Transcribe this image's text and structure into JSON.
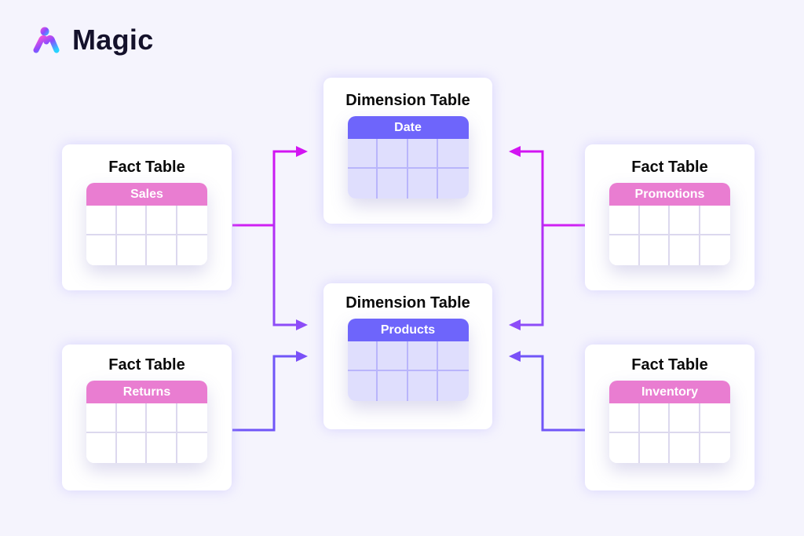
{
  "brand": {
    "name": "Magic",
    "logo_icon": "magic-person-logo-icon"
  },
  "colors": {
    "background": "#f5f4fd",
    "fact_header": "#e97dd1",
    "dimension_header": "#6e65fb",
    "dimension_body": "#dfdefd",
    "connector_magenta": "#d214f2",
    "connector_violet": "#8d4cf8",
    "connector_blue": "#6a5cf8"
  },
  "diagram": {
    "type": "star-schema",
    "dimension_tables": [
      {
        "id": "date",
        "title": "Dimension Table",
        "name": "Date"
      },
      {
        "id": "products",
        "title": "Dimension Table",
        "name": "Products"
      }
    ],
    "fact_tables": [
      {
        "id": "sales",
        "title": "Fact Table",
        "name": "Sales",
        "side": "left",
        "links_to": [
          "date",
          "products"
        ]
      },
      {
        "id": "returns",
        "title": "Fact Table",
        "name": "Returns",
        "side": "left",
        "links_to": [
          "products"
        ]
      },
      {
        "id": "promotions",
        "title": "Fact Table",
        "name": "Promotions",
        "side": "right",
        "links_to": [
          "date",
          "products"
        ]
      },
      {
        "id": "inventory",
        "title": "Fact Table",
        "name": "Inventory",
        "side": "right",
        "links_to": [
          "products"
        ]
      }
    ],
    "table_grid": {
      "rows": 2,
      "columns": 4
    }
  }
}
